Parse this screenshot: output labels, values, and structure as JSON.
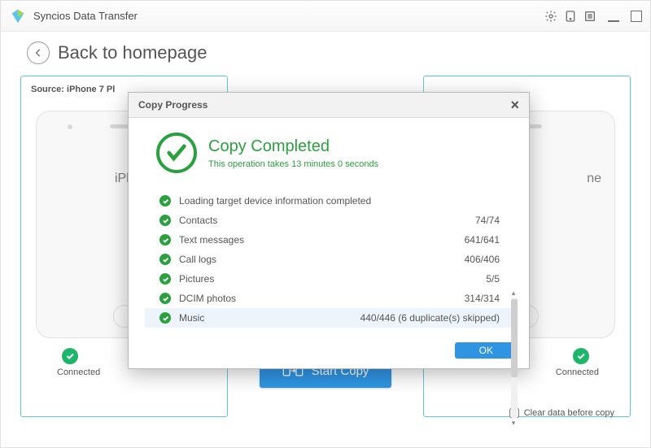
{
  "app": {
    "title": "Syncios Data Transfer"
  },
  "back_label": "Back to homepage",
  "source_panel": {
    "label": "Source: iPhone 7 Pl",
    "device": "iPh",
    "status": "Connected"
  },
  "target_panel": {
    "device": "ne",
    "status": "Connected"
  },
  "center": {
    "start_copy": "Start Copy",
    "clear_label": "Clear data before copy"
  },
  "modal": {
    "title": "Copy Progress",
    "status_title": "Copy Completed",
    "status_sub": "This operation takes 13 minutes 0 seconds",
    "items": [
      {
        "label": "Loading target device information completed",
        "count": ""
      },
      {
        "label": "Contacts",
        "count": "74/74"
      },
      {
        "label": "Text messages",
        "count": "641/641"
      },
      {
        "label": "Call logs",
        "count": "406/406"
      },
      {
        "label": "Pictures",
        "count": "5/5"
      },
      {
        "label": "DCIM photos",
        "count": "314/314"
      },
      {
        "label": "Music",
        "count": "440/446 (6 duplicate(s) skipped)"
      }
    ],
    "ok": "OK"
  }
}
